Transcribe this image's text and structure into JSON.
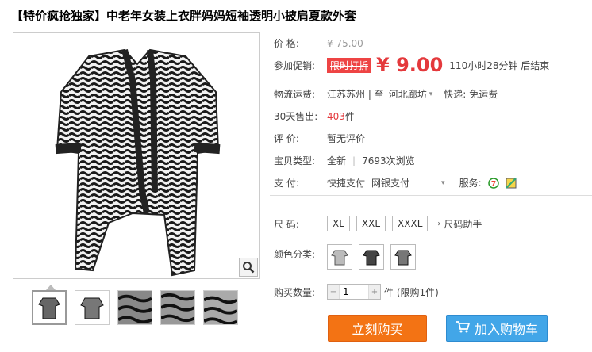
{
  "product": {
    "title": "【特价疯抢独家】中老年女装上衣胖妈妈短袖透明小披肩夏款外套"
  },
  "price": {
    "label": "价 格:",
    "original": "¥ 75.00"
  },
  "promo": {
    "label": "参加促销:",
    "tag": "限时打折",
    "price": "¥ 9.00",
    "time": "110小时28分钟 后结束"
  },
  "shipping": {
    "label": "物流运费:",
    "from": "江苏苏州 | 至",
    "to": "河北廊坊",
    "fee": "快递: 免运费"
  },
  "sales": {
    "label": "30天售出:",
    "count": "403",
    "unit": "件"
  },
  "rating": {
    "label": "评 价:",
    "value": "暂无评价"
  },
  "item_type": {
    "label": "宝贝类型:",
    "condition": "全新",
    "views": "7693次浏览"
  },
  "payment": {
    "label": "支 付:",
    "methods": [
      "快捷支付",
      "网银支付"
    ],
    "service_label": "服务:"
  },
  "size": {
    "label": "尺 码:",
    "options": [
      "XL",
      "XXL",
      "XXXL"
    ],
    "help": "尺码助手"
  },
  "color": {
    "label": "颜色分类:"
  },
  "quantity": {
    "label": "购买数量:",
    "value": "1",
    "unit": "件 (限购1件)"
  },
  "actions": {
    "buy": "立刻购买",
    "cart": "加入购物车"
  },
  "icons": {
    "zoom": "magnifier-icon",
    "cart": "shopping-cart-icon",
    "service_1": "seven-day-return-icon",
    "service_2": "guarantee-icon"
  },
  "colors": {
    "accent_red": "#e4393c",
    "buy_orange": "#f37314",
    "cart_blue": "#42a6e8"
  }
}
